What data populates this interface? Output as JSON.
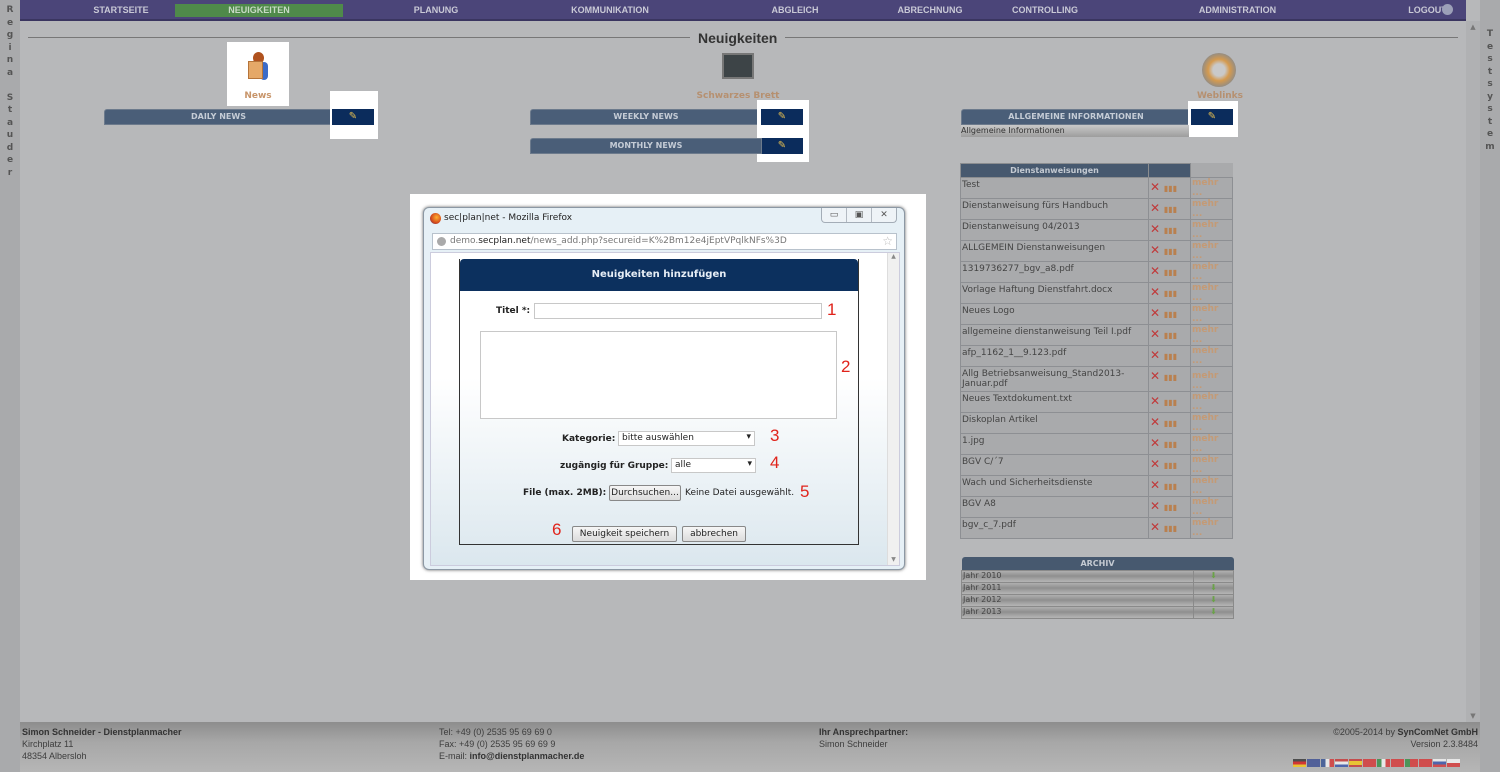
{
  "nav": {
    "items": [
      {
        "label": "STARTSEITE"
      },
      {
        "label": "NEUIGKEITEN",
        "active": true
      },
      {
        "label": "PLANUNG"
      },
      {
        "label": "KOMMUNIKATION"
      },
      {
        "label": "ABGLEICH"
      },
      {
        "label": "ABRECHNUNG"
      },
      {
        "label": "CONTROLLING"
      },
      {
        "label": "ADMINISTRATION"
      },
      {
        "label": "LOGOUT"
      }
    ],
    "help_icon": "help-icon"
  },
  "left_user": "Regina Stauder",
  "right_system": "Testsystem",
  "page_title": "Neuigkeiten",
  "sections": {
    "news": "News",
    "board": "Schwarzes Brett",
    "weblinks": "Weblinks"
  },
  "bars": {
    "daily": "DAILY NEWS",
    "weekly": "WEEKLY NEWS",
    "monthly": "MONTHLY NEWS",
    "general": "ALLGEMEINE INFORMATIONEN",
    "general_item": "Allgemeine Informationen"
  },
  "dienst": {
    "header": "Dienstanweisungen",
    "more": "mehr ...",
    "rows": [
      "Test",
      "Dienstanweisung fürs Handbuch",
      "Dienstanweisung 04/2013",
      "ALLGEMEIN Dienstanweisungen",
      "1319736277_bgv_a8.pdf",
      "Vorlage Haftung Dienstfahrt.docx",
      "Neues Logo",
      "allgemeine dienstanweisung Teil I.pdf",
      "afp_1162_1__9.123.pdf",
      "Allg Betriebsanweisung_Stand2013-Januar.pdf",
      "Neues Textdokument.txt",
      "Diskoplan Artikel",
      "1.jpg",
      "BGV C/´7",
      "Wach und Sicherheitsdienste",
      "BGV A8",
      "bgv_c_7.pdf"
    ]
  },
  "archiv": {
    "header": "ARCHIV",
    "rows": [
      "Jahr 2010",
      "Jahr 2011",
      "Jahr 2012",
      "Jahr 2013"
    ]
  },
  "popup": {
    "window_title": "sec|plan|net - Mozilla Firefox",
    "url_host_pre": "demo.",
    "url_host": "secplan.net",
    "url_path": "/news_add.php?secureid=K%2Bm12e4jEptVPqlkNFs%3D",
    "form_title": "Neuigkeiten hinzufügen",
    "title_label": "Titel *:",
    "title_value": "",
    "body_value": "",
    "category_label": "Kategorie:",
    "category_value": "bitte auswählen",
    "group_label": "zugängig für Gruppe:",
    "group_value": "alle",
    "file_label": "File (max. 2MB):",
    "browse_label": "Durchsuchen...",
    "no_file": "Keine Datei ausgewählt.",
    "save_label": "Neuigkeit speichern",
    "cancel_label": "abbrechen",
    "markers": [
      "1",
      "2",
      "3",
      "4",
      "5",
      "6"
    ]
  },
  "footer": {
    "name": "Simon Schneider - Dienstplanmacher",
    "street": "Kirchplatz 11",
    "city": "48354 Albersloh",
    "tel": "Tel: +49 (0) 2535 95 69 69 0",
    "fax": "Fax: +49 (0) 2535 95 69 69 9",
    "email_label": "E-mail:",
    "email": "info@dienstplanmacher.de",
    "contact_label": "Ihr Ansprechpartner:",
    "contact": "Simon Schneider",
    "copyright": "©2005-2014 by",
    "company": "SynComNet GmbH",
    "version": "Version 2.3.8484"
  },
  "flags": [
    "de",
    "en",
    "fr",
    "nl",
    "es",
    "ch",
    "it",
    "tr",
    "pt",
    "cn",
    "ru",
    "pl"
  ]
}
